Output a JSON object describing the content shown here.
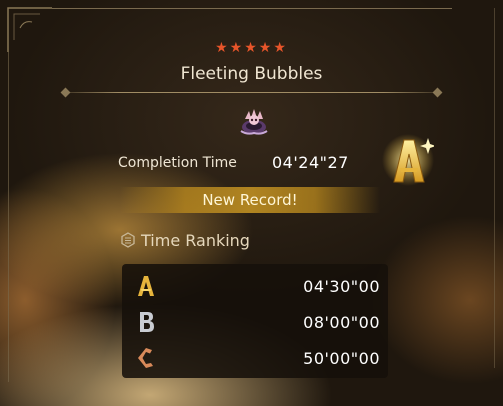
{
  "quest": {
    "stars": "★★★★★",
    "title": "Fleeting Bubbles"
  },
  "result": {
    "completion_label": "Completion Time",
    "completion_time": "04'24\"27",
    "rank": "A",
    "new_record": "New Record!"
  },
  "ranking": {
    "header": "Time Ranking",
    "rows": [
      {
        "grade": "A",
        "time": "04'30\"00",
        "color": "#e6b43c"
      },
      {
        "grade": "B",
        "time": "08'00\"00",
        "color": "#c9ccd2"
      },
      {
        "grade": "C",
        "time": "50'00\"00",
        "color": "#d98a5a"
      }
    ]
  },
  "colors": {
    "star": "#e8552a",
    "gold": "#e6b43c"
  }
}
